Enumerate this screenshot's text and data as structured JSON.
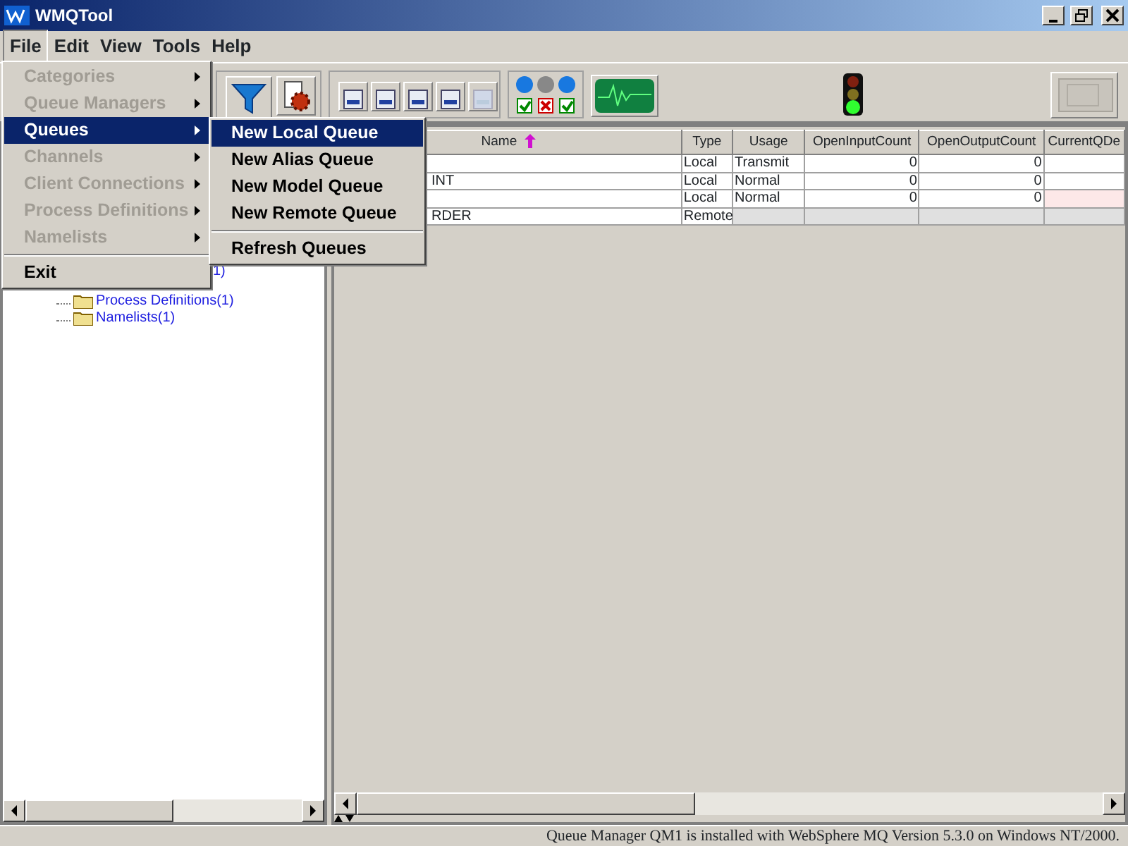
{
  "window": {
    "title": "WMQTool"
  },
  "menubar": [
    {
      "label": "File",
      "selected": true
    },
    {
      "label": "Edit",
      "selected": false
    },
    {
      "label": "View",
      "selected": false
    },
    {
      "label": "Tools",
      "selected": false
    },
    {
      "label": "Help",
      "selected": false
    }
  ],
  "file_menu": {
    "items": [
      {
        "kind": "submenu",
        "label": "Categories",
        "disabled": true,
        "selected": false
      },
      {
        "kind": "submenu",
        "label": "Queue Managers",
        "disabled": true,
        "selected": false
      },
      {
        "kind": "submenu",
        "label": "Queues",
        "disabled": false,
        "selected": true
      },
      {
        "kind": "submenu",
        "label": "Channels",
        "disabled": true,
        "selected": false
      },
      {
        "kind": "submenu",
        "label": "Client Connections",
        "disabled": true,
        "selected": false
      },
      {
        "kind": "submenu",
        "label": "Process Definitions",
        "disabled": true,
        "selected": false
      },
      {
        "kind": "submenu",
        "label": "Namelists",
        "disabled": true,
        "selected": false
      },
      {
        "kind": "separator"
      },
      {
        "kind": "item",
        "label": "Exit",
        "disabled": false,
        "selected": false
      }
    ]
  },
  "queues_submenu": {
    "items": [
      {
        "kind": "item",
        "label": "New Local Queue",
        "selected": true
      },
      {
        "kind": "item",
        "label": "New Alias Queue",
        "selected": false
      },
      {
        "kind": "item",
        "label": "New Model Queue",
        "selected": false
      },
      {
        "kind": "item",
        "label": "New Remote Queue",
        "selected": false
      },
      {
        "kind": "separator"
      },
      {
        "kind": "item",
        "label": "Refresh Queues",
        "selected": false
      }
    ]
  },
  "tree": {
    "items": [
      {
        "label": "1)"
      },
      {
        "label": "Process Definitions(1)"
      },
      {
        "label": "Namelists(1)"
      }
    ]
  },
  "table": {
    "columns": [
      {
        "label": "Name",
        "sorted": true
      },
      {
        "label": "Type",
        "sorted": false
      },
      {
        "label": "Usage",
        "sorted": false
      },
      {
        "label": "OpenInputCount",
        "sorted": false
      },
      {
        "label": "OpenOutputCount",
        "sorted": false
      },
      {
        "label": "CurrentQDe",
        "sorted": false
      }
    ],
    "rows": [
      {
        "kind": "local",
        "alert": false,
        "cells": [
          "",
          "Local",
          "Transmit",
          "0",
          "0",
          ""
        ]
      },
      {
        "kind": "local",
        "alert": false,
        "cells": [
          "INT",
          "Local",
          "Normal",
          "0",
          "0",
          ""
        ]
      },
      {
        "kind": "local",
        "alert": true,
        "cells": [
          "",
          "Local",
          "Normal",
          "0",
          "0",
          ""
        ]
      },
      {
        "kind": "remote",
        "alert": false,
        "cells": [
          "RDER",
          "Remote",
          "",
          "",
          "",
          ""
        ]
      }
    ]
  },
  "status_bar": {
    "text": "Queue Manager QM1 is installed with WebSphere MQ Version 5.3.0 on Windows NT/2000."
  }
}
